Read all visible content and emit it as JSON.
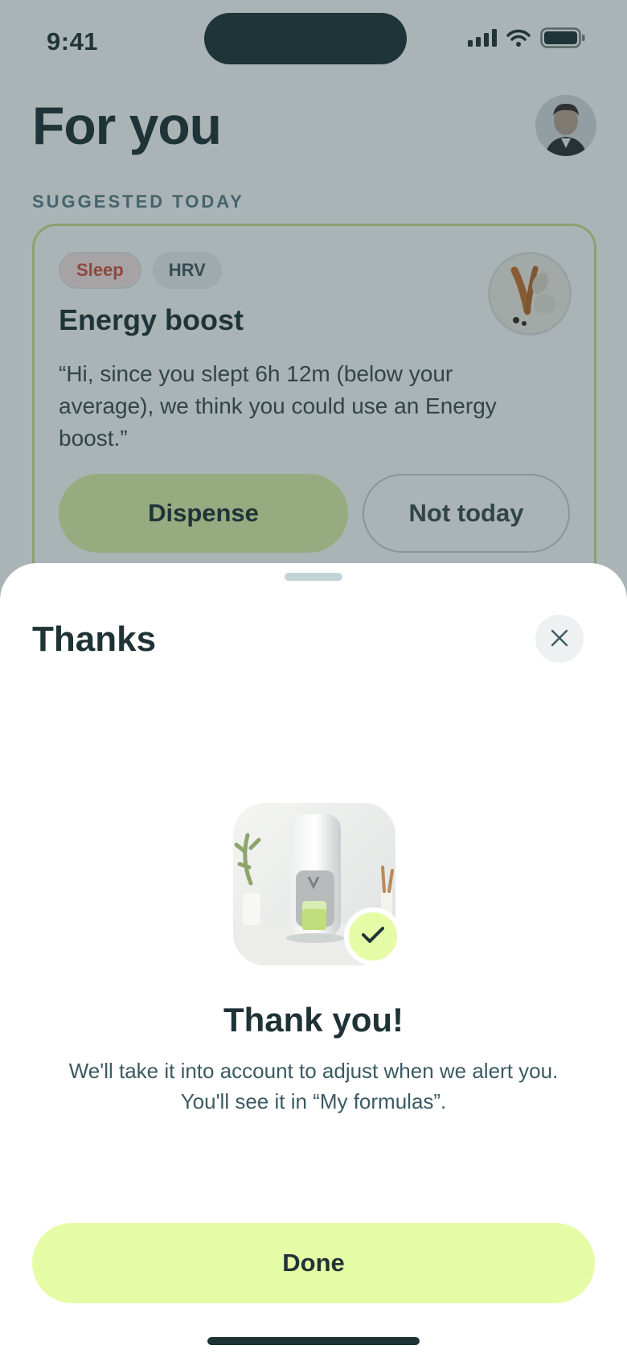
{
  "status_bar": {
    "time": "9:41"
  },
  "background": {
    "page_title": "For you",
    "section_label": "SUGGESTED TODAY",
    "card": {
      "chips": [
        "Sleep",
        "HRV"
      ],
      "title": "Energy boost",
      "quote": "“Hi, since you slept 6h 12m (below your average), we think you could use an Energy boost.”",
      "primary_action": "Dispense",
      "secondary_action": "Not today"
    }
  },
  "sheet": {
    "title": "Thanks",
    "heading": "Thank you!",
    "message_line1": "We'll take it into account to adjust when we alert you.",
    "message_line2": "You'll see it in “My formulas”.",
    "done_label": "Done"
  },
  "colors": {
    "ink": "#1f3236",
    "accent_lime": "#e6fba6",
    "sleep_chip_text": "#d0523f",
    "section_label": "#5b7e87",
    "card_border": "#cfe48f"
  },
  "icons": [
    "cellular-icon",
    "wifi-icon",
    "battery-icon",
    "close-icon",
    "checkmark-icon"
  ]
}
